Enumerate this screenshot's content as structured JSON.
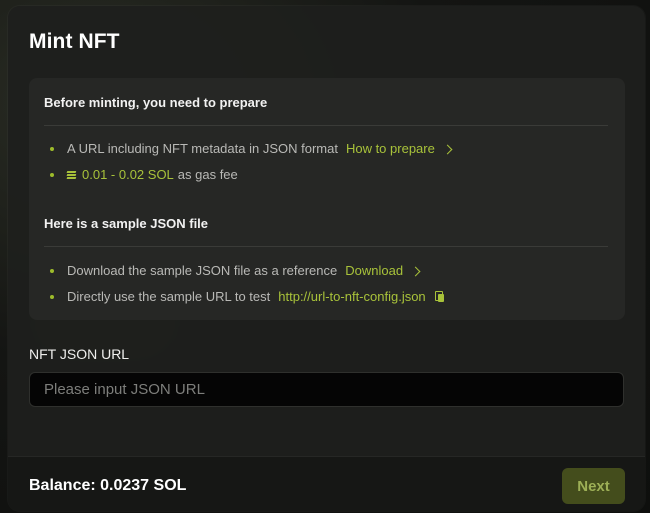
{
  "modal": {
    "title": "Mint NFT"
  },
  "prepare": {
    "heading": "Before minting, you need to prepare",
    "metadata_text": "A URL including NFT metadata in JSON format",
    "metadata_link": "How to prepare",
    "gas_amount": "0.01 - 0.02 SOL",
    "gas_suffix": "as gas fee",
    "gas_icon": "solana-icon"
  },
  "sample": {
    "heading": "Here is a sample JSON file",
    "download_text": "Download the sample JSON file as a reference",
    "download_link": "Download",
    "url_text": "Directly use the sample URL to test",
    "sample_url": "http://url-to-nft-config.json",
    "copy_icon": "copy-icon"
  },
  "form": {
    "label": "NFT JSON URL",
    "placeholder": "Please input JSON URL",
    "value": ""
  },
  "footer": {
    "balance": "Balance: 0.0237 SOL",
    "next_label": "Next"
  },
  "colors": {
    "accent": "#a8c23a",
    "button_bg": "#444d1c",
    "modal_bg": "#1e1f1d",
    "card_bg": "#262725"
  }
}
